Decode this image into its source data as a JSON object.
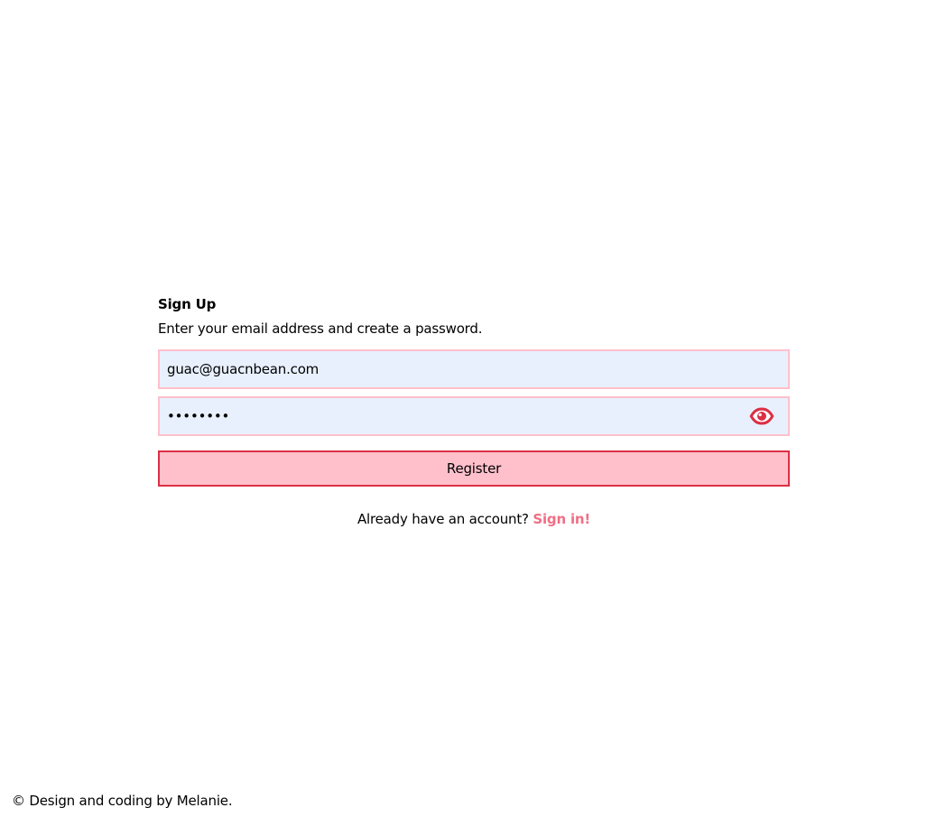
{
  "form": {
    "title": "Sign Up",
    "subtitle": "Enter your email address and create a password.",
    "email_value": "guac@guacnbean.com",
    "password_value": "••••••••",
    "register_label": "Register"
  },
  "signin": {
    "prompt": "Already have an account?",
    "link_label": "Sign in!"
  },
  "footer": {
    "text": "© Design and coding by Melanie."
  },
  "icons": {
    "password_toggle": "eye-icon"
  },
  "colors": {
    "field_border": "#ffc0cb",
    "field_background": "#e8f0fe",
    "button_background": "#ffc0cb",
    "button_border": "#dc2f45",
    "link": "#ef6f85",
    "icon": "#dc2f45"
  }
}
